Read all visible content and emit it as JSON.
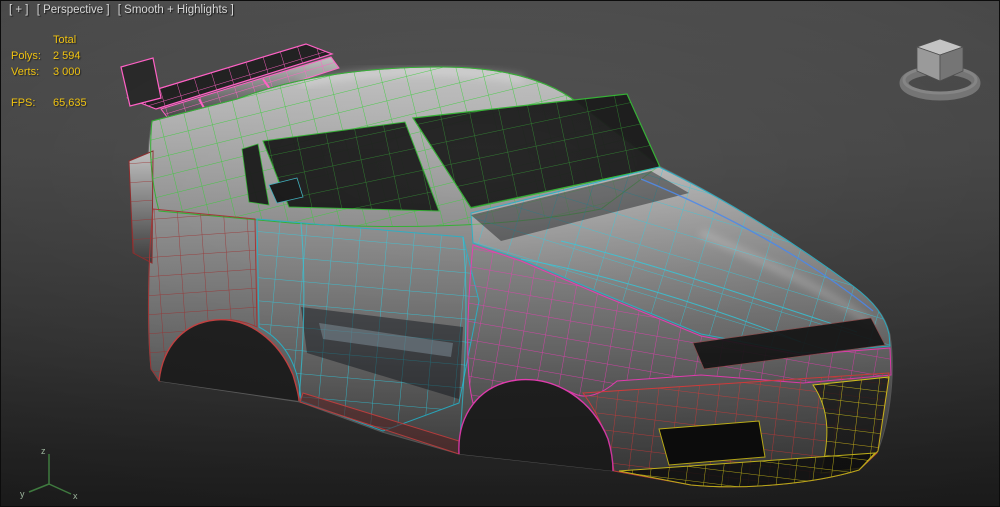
{
  "viewport": {
    "menus": [
      "[ + ]",
      "[ Perspective ]",
      "[ Smooth + Highlights ]"
    ]
  },
  "stats": {
    "total_label": "Total",
    "rows": [
      {
        "label": "Polys:",
        "value": "2 594"
      },
      {
        "label": "Verts:",
        "value": "3 000"
      }
    ],
    "fps_label": "FPS:",
    "fps_value": "65,635",
    "text_color": "#efc211"
  },
  "axis_tripod": {
    "x": "x",
    "y": "y",
    "z": "z"
  },
  "icons": {
    "viewcube": "view-cube-gizmo",
    "axis_tripod": "world-axis-tripod"
  },
  "wireframe_colors": {
    "green": "#33cc33",
    "cyan": "#2ec8dc",
    "blue": "#4a86e8",
    "magenta": "#e23caf",
    "pink": "#ff5ec4",
    "red": "#d43c3c",
    "dark_red": "#993030",
    "yellow": "#d9c81d"
  }
}
